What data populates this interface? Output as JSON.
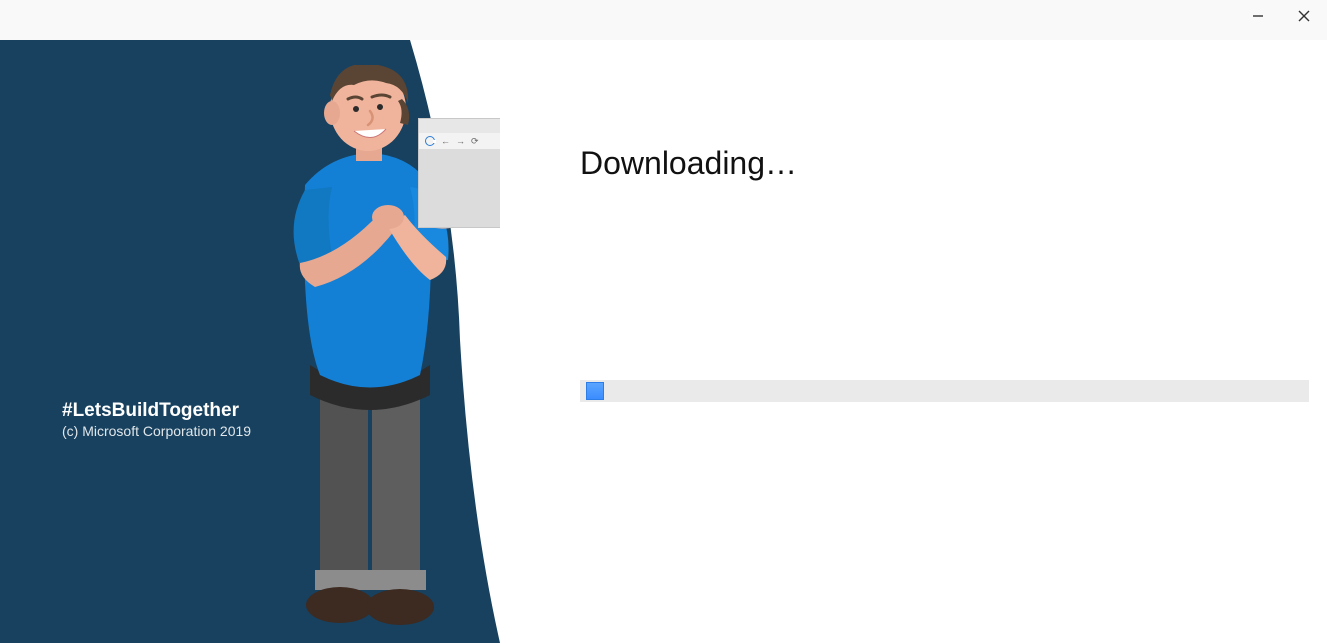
{
  "titlebar": {
    "minimize_label": "Minimize",
    "close_label": "Close"
  },
  "sidebar": {
    "hashtag": "#LetsBuildTogether",
    "copyright": "(c) Microsoft Corporation 2019",
    "illustration": {
      "browser_icon": "edge-icon"
    }
  },
  "main": {
    "status_text": "Downloading…",
    "progress_percent": 2
  },
  "colors": {
    "sidebar_bg": "#17415f",
    "accent_blue": "#1380d6",
    "progress_fill": "#3b8cff"
  }
}
